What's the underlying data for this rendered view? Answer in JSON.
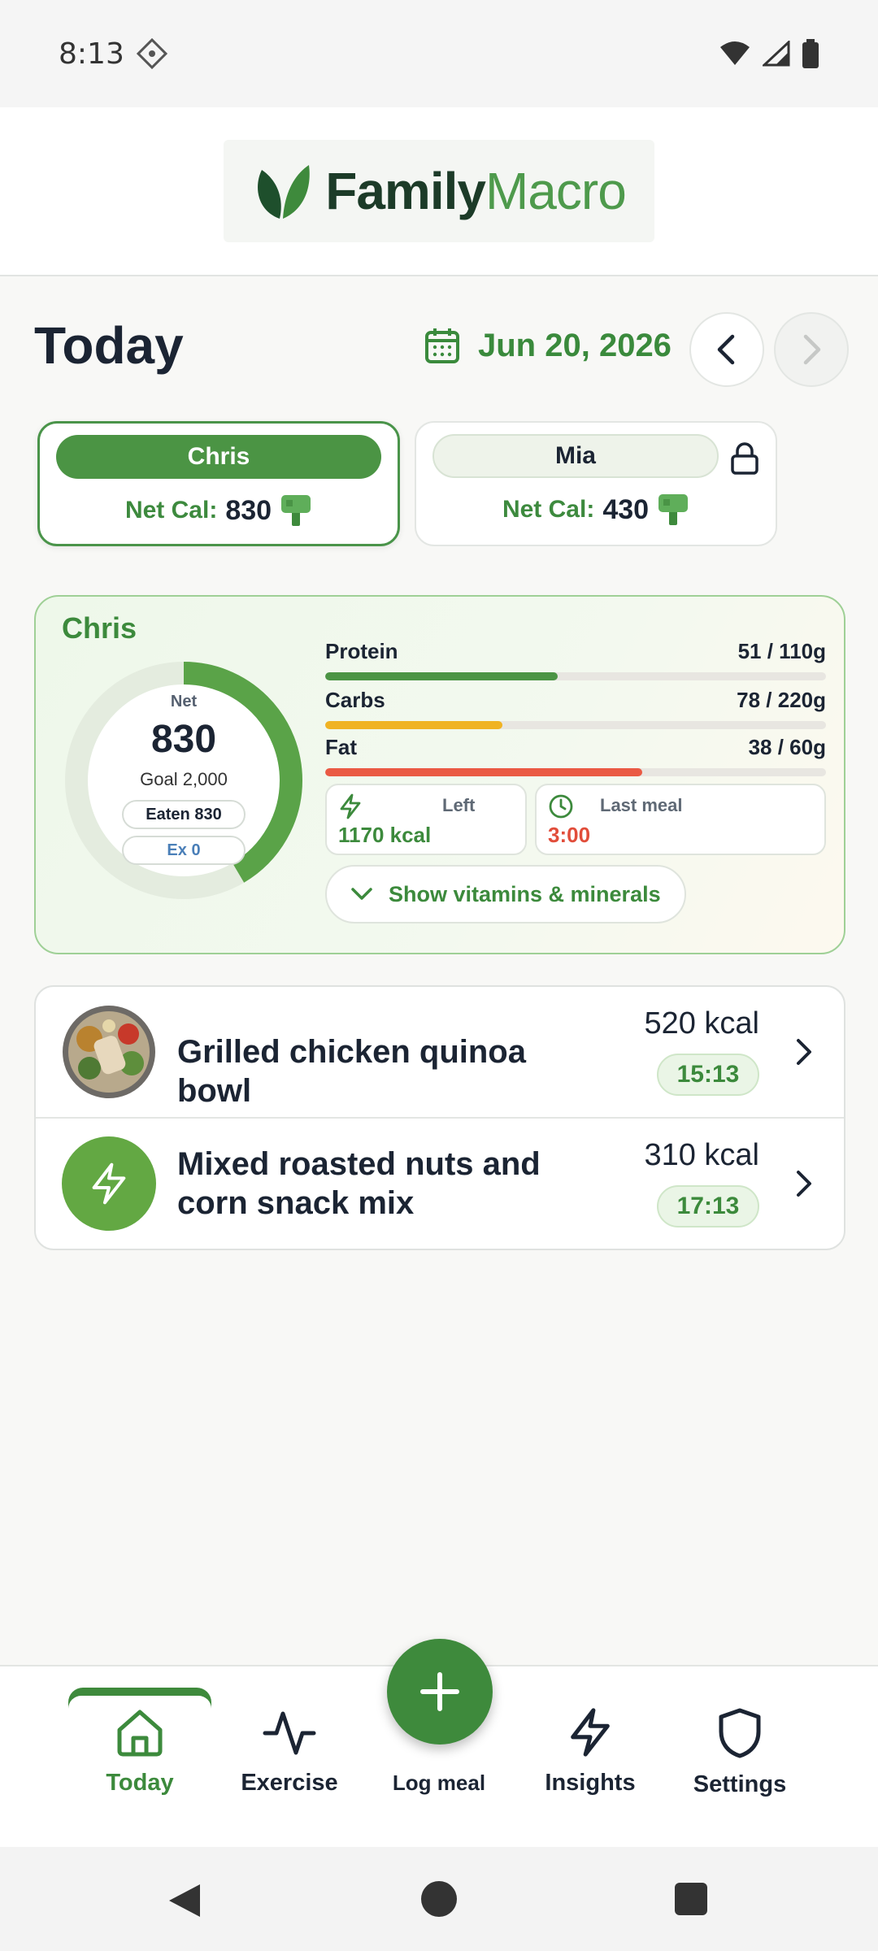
{
  "status": {
    "time": "8:13"
  },
  "app": {
    "logo_part1": "Family",
    "logo_part2": "Macro"
  },
  "header": {
    "title": "Today",
    "date": "Jun 20, 2026"
  },
  "people": [
    {
      "name": "Chris",
      "net_label": "Net Cal:",
      "net_value": "830",
      "active": true
    },
    {
      "name": "Mia",
      "net_label": "Net Cal:",
      "net_value": "430",
      "active": false
    }
  ],
  "summary": {
    "name": "Chris",
    "ring": {
      "net_label": "Net",
      "net_value": "830",
      "goal": "Goal 2,000",
      "eaten": "Eaten 830",
      "exercise": "Ex 0",
      "progress": 0.415
    },
    "macros": [
      {
        "name": "Protein",
        "value": "51 / 110g",
        "fraction": 0.4636,
        "color": "#4b9444"
      },
      {
        "name": "Carbs",
        "value": "78 / 220g",
        "fraction": 0.3545,
        "color": "#f0b323"
      },
      {
        "name": "Fat",
        "value": "38 / 60g",
        "fraction": 0.6333,
        "color": "#ea5a44"
      }
    ],
    "left": {
      "label": "Left",
      "value": "1170 kcal"
    },
    "last_meal": {
      "label": "Last meal",
      "value": "3:00"
    },
    "vitamins_button": "Show vitamins & minerals"
  },
  "meals": [
    {
      "name": "Grilled chicken quinoa bowl",
      "kcal": "520 kcal",
      "time": "15:13"
    },
    {
      "name": "Mixed roasted nuts and corn snack mix",
      "kcal": "310 kcal",
      "time": "17:13"
    }
  ],
  "nav": {
    "today": "Today",
    "exercise": "Exercise",
    "log_meal": "Log meal",
    "insights": "Insights",
    "settings": "Settings"
  },
  "colors": {
    "accent": "#3e8a3c",
    "brand_dark": "#1c3b28",
    "text": "#1b2433",
    "warning": "#e14d3a"
  }
}
